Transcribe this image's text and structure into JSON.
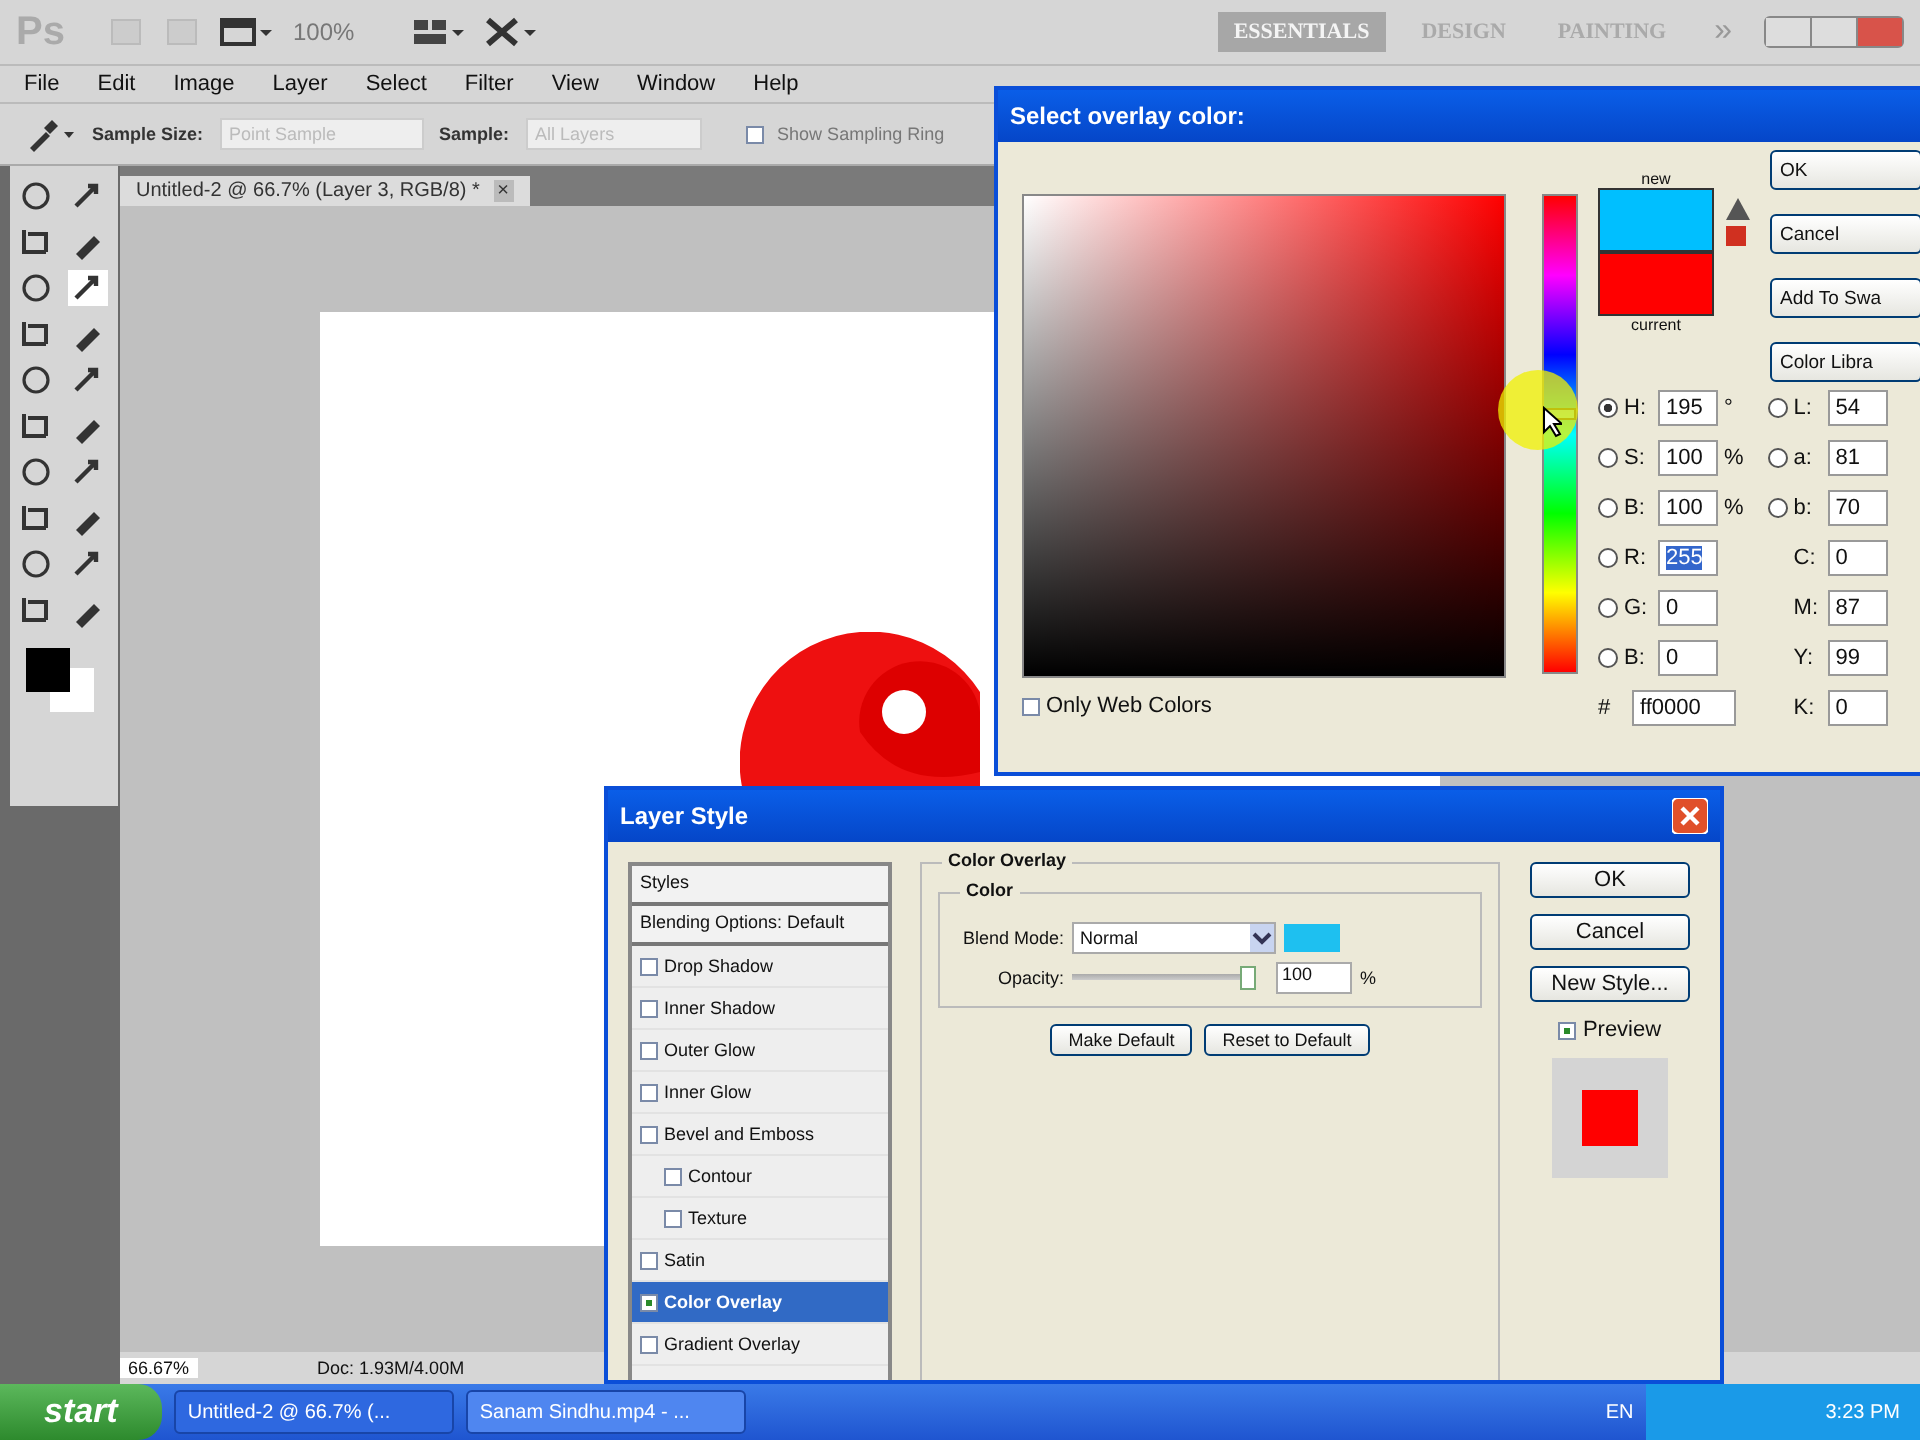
{
  "app_bar": {
    "logo": "Ps",
    "zoom": "100%",
    "workspaces": [
      {
        "label": "ESSENTIALS",
        "selected": true
      },
      {
        "label": "DESIGN",
        "selected": false
      },
      {
        "label": "PAINTING",
        "selected": false
      }
    ],
    "more": "»"
  },
  "menu": [
    "File",
    "Edit",
    "Image",
    "Layer",
    "Select",
    "Filter",
    "View",
    "Window",
    "Help"
  ],
  "options_bar": {
    "sample_size_label": "Sample Size:",
    "sample_size_value": "Point Sample",
    "sample_label": "Sample:",
    "sample_value": "All Layers",
    "ring": {
      "label": "Show Sampling Ring",
      "checked": false
    }
  },
  "tools": [
    {
      "selected": false
    },
    {
      "selected": false
    },
    {
      "selected": false
    },
    {
      "selected": false
    },
    {
      "selected": false
    },
    {
      "selected": true
    },
    {
      "selected": false
    },
    {
      "selected": false
    },
    {
      "selected": false
    },
    {
      "selected": false
    },
    {
      "selected": false
    },
    {
      "selected": false
    },
    {
      "selected": false
    },
    {
      "selected": false
    },
    {
      "selected": false
    },
    {
      "selected": false
    },
    {
      "selected": false
    },
    {
      "selected": false
    },
    {
      "selected": false
    },
    {
      "selected": false
    }
  ],
  "document_tab": {
    "title": "Untitled-2 @ 66.7% (Layer 3, RGB/8) *",
    "close": "×"
  },
  "status_bar": {
    "zoom": "66.67%",
    "doc": "Doc: 1.93M/4.00M"
  },
  "color_picker": {
    "title": "Select overlay color:",
    "new_label": "new",
    "current_label": "current",
    "hue_slider": {
      "level": 0.54
    },
    "buttons": [
      "OK",
      "Cancel",
      "Add To Swa",
      "Color Libra"
    ],
    "hsb": [
      {
        "label": "H:",
        "value": "195",
        "unit": "°",
        "selected": true
      },
      {
        "label": "S:",
        "value": "100",
        "unit": "%",
        "selected": false
      },
      {
        "label": "B:",
        "value": "100",
        "unit": "%",
        "selected": false
      }
    ],
    "rgb": [
      {
        "label": "R:",
        "value": "255",
        "selected": false,
        "highlighted": true
      },
      {
        "label": "G:",
        "value": "0",
        "selected": false,
        "highlighted": false
      },
      {
        "label": "B:",
        "value": "0",
        "selected": false,
        "highlighted": false
      }
    ],
    "lab": [
      {
        "label": "L:",
        "value": "54",
        "selected": false
      },
      {
        "label": "a:",
        "value": "81",
        "selected": false
      },
      {
        "label": "b:",
        "value": "70",
        "selected": false
      }
    ],
    "cmyk": [
      {
        "label": "C:",
        "value": "0"
      },
      {
        "label": "M:",
        "value": "87"
      },
      {
        "label": "Y:",
        "value": "99"
      },
      {
        "label": "K:",
        "value": "0"
      }
    ],
    "hex_label": "#",
    "hex": "ff0000",
    "web_colors": {
      "label": "Only Web Colors",
      "checked": false
    }
  },
  "layer_style": {
    "title": "Layer Style",
    "headers": [
      "Styles",
      "Blending Options: Default"
    ],
    "effects": [
      {
        "label": "Drop Shadow",
        "checked": false,
        "selected": false
      },
      {
        "label": "Inner Shadow",
        "checked": false,
        "selected": false
      },
      {
        "label": "Outer Glow",
        "checked": false,
        "selected": false
      },
      {
        "label": "Inner Glow",
        "checked": false,
        "selected": false
      },
      {
        "label": "Bevel and Emboss",
        "checked": false,
        "selected": false,
        "children": [
          {
            "label": "Contour",
            "checked": false,
            "selected": false
          },
          {
            "label": "Texture",
            "checked": false,
            "selected": false
          }
        ]
      },
      {
        "label": "Satin",
        "checked": false,
        "selected": false
      },
      {
        "label": "Color Overlay",
        "checked": true,
        "selected": true
      },
      {
        "label": "Gradient Overlay",
        "checked": false,
        "selected": false
      }
    ],
    "section": "Color Overlay",
    "group": "Color",
    "blend_label": "Blend Mode:",
    "blend_value": "Normal",
    "opacity_label": "Opacity:",
    "opacity": {
      "level": 1.0
    },
    "opacity_value": "100",
    "opacity_unit": "%",
    "defaults": [
      "Make Default",
      "Reset to Default"
    ],
    "buttons": [
      "OK",
      "Cancel",
      "New Style..."
    ],
    "preview": {
      "label": "Preview",
      "checked": true
    }
  },
  "taskbar": {
    "start": "start",
    "tasks": [
      {
        "label": "Untitled-2 @ 66.7% (...",
        "selected": false
      },
      {
        "label": "Sanam Sindhu.mp4 - ...",
        "selected": true
      }
    ],
    "lang": "EN",
    "time": "3:23 PM"
  }
}
